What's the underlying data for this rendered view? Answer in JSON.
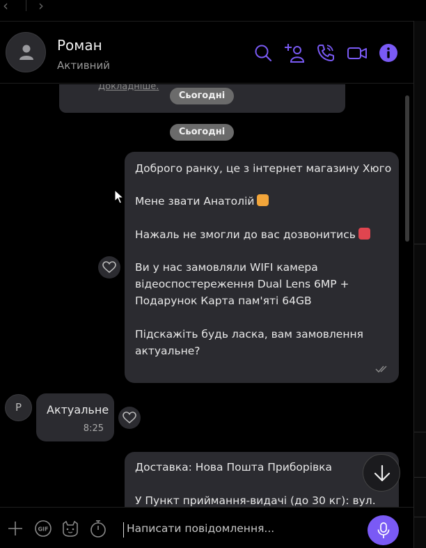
{
  "colors": {
    "accent": "#7a5af5",
    "bubble": "#2b2b30",
    "pill": "#6b6b6b",
    "background": "#000000"
  },
  "header": {
    "name": "Роман",
    "status": "Активний",
    "icons": [
      "search-icon",
      "add-participant-icon",
      "phone-icon",
      "video-call-icon",
      "info-icon"
    ]
  },
  "chat": {
    "previous_link": "Докладніше.",
    "date_pills": [
      "Сьогодні",
      "Сьогодні"
    ],
    "outgoing_1": {
      "lines": [
        "Доброго ранку, це з інтернет магазину Хюго",
        "Мене звати Анатолій",
        "Нажаль не змогли до вас дозвонитись",
        "Ви у нас замовляли WIFI камера",
        "відеоспостереження Dual Lens 6MP +",
        "Подарунок Карта пам'яті 64GB",
        "Підскажіть будь ласка, вам замовлення",
        "актуальне?"
      ]
    },
    "incoming_1": {
      "avatar_letter": "Р",
      "text": "Актуальне",
      "time": "8:25"
    },
    "outgoing_2": {
      "lines": [
        "Доставка: Нова Пошта  Приборівка",
        "У Пункт приймання-видачі (до 30 кг): вул."
      ]
    }
  },
  "composer": {
    "placeholder": "Написати повідомлення...",
    "icons": [
      "plus-icon",
      "gif-icon",
      "sticker-icon",
      "timer-icon",
      "microphone-icon"
    ]
  }
}
